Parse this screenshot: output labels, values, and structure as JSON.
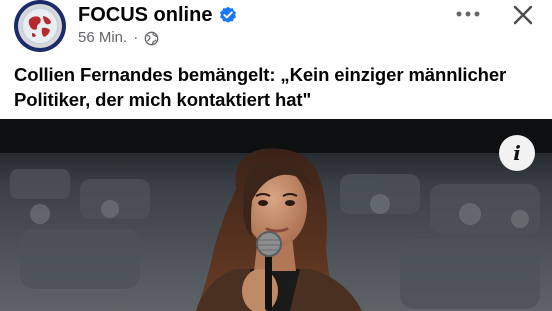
{
  "post": {
    "page_name": "FOCUS online",
    "timestamp": "56 Min.",
    "separator": "·",
    "visibility_icon": "globe-icon",
    "caption": "Collien Fernandes bemängelt: „Kein einziger männlicher Politiker, der mich kontaktiert hat\"",
    "colors": {
      "verified_badge": "#1877f2",
      "text_primary": "#050505",
      "text_secondary": "#65676b"
    },
    "icons": {
      "more": "more-horizontal-icon",
      "close": "close-icon",
      "info": "info-icon",
      "verified": "verified-badge-icon"
    }
  }
}
